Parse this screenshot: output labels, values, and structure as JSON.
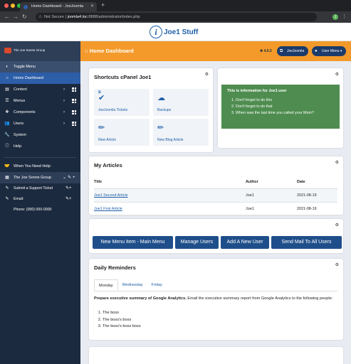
{
  "browser": {
    "tab_title": "Home Dashboard - JoeJoomla",
    "url_prefix": "Not Secure",
    "url_host": "joomla4.loc",
    "url_path": ":8888/administrator/index.php",
    "profile_initial": "J"
  },
  "brand": {
    "logo_letter": "i",
    "name": "Joe1 Stuff"
  },
  "sidebar": {
    "group_name": "The Joe Sonne Group",
    "toggle_label": "Toggle Menu",
    "items": [
      {
        "label": "Home Dashboard",
        "icon": "home-icon"
      },
      {
        "label": "Content",
        "icon": "file-icon"
      },
      {
        "label": "Menus",
        "icon": "list-icon"
      },
      {
        "label": "Components",
        "icon": "cubes-icon"
      },
      {
        "label": "Users",
        "icon": "users-icon"
      },
      {
        "label": "System",
        "icon": "wrench-icon"
      },
      {
        "label": "Help",
        "icon": "info-icon"
      }
    ],
    "help_heading": "When You Need Help:",
    "help_group": "The Joe Sonne Group",
    "support_ticket": "Submit a Support Ticket",
    "email": "Email:",
    "phone": "Phone: (000) 000-0000"
  },
  "topbar": {
    "title": "Home Dashboard",
    "version": "4.0.2",
    "site_button": "JoeJoomla",
    "user_menu": "User Menu"
  },
  "shortcuts": {
    "title": "Shortcuts cPanel Joe1",
    "tiles": [
      {
        "label": "JoeJoomla Tickets",
        "icon": "check-circle-icon"
      },
      {
        "label": "Backups",
        "icon": "cloud-upload-icon"
      },
      {
        "label": "New Article",
        "icon": "pencil-icon"
      },
      {
        "label": "New Blog Article",
        "icon": "pencil-icon"
      }
    ]
  },
  "info": {
    "title": "This is information for Joe1 user",
    "items": [
      "Don't forget to do this",
      "Don't forget to do that",
      "When was the last time you called your Mom?"
    ]
  },
  "articles": {
    "title": "My Articles",
    "columns": [
      "Title",
      "Author",
      "Date"
    ],
    "rows": [
      {
        "title": "Joe1 Second Article",
        "author": "Joe1",
        "date": "2021-08-19"
      },
      {
        "title": "Joe1 First Article",
        "author": "Joe1",
        "date": "2021-08-19"
      }
    ]
  },
  "actions": {
    "buttons": [
      "New Menu Item - Main Menu",
      "Manage Users",
      "Add A New User",
      "Send Mail To All Users"
    ]
  },
  "reminders": {
    "title": "Daily Reminders",
    "tabs": [
      "Monday",
      "Wednesday",
      "Friday"
    ],
    "active_tab": "Monday",
    "bold_text": "Prepare executive summary of Google Analytics.",
    "text": " Email the executive summary report from Google Analytics to the following people:",
    "list": [
      "The boss",
      "The boss's boss",
      "The boss's boss boss"
    ]
  },
  "colors": {
    "orange": "#f39a2b",
    "sidebar": "#1c2a3f",
    "primary": "#1d5fa8",
    "green": "#4e8d4f"
  }
}
